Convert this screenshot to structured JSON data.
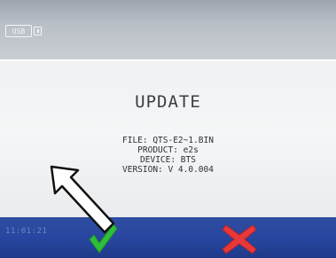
{
  "status_bar": {
    "usb_label": "USB",
    "usb_icon": "usb-connected-icon"
  },
  "dialog": {
    "title": "UPDATE",
    "lines": [
      "FILE: QTS-E2~1.BIN",
      "PRODUCT: e2s",
      "DEVICE: BTS",
      "VERSION: V 4.0.004"
    ]
  },
  "footer": {
    "clock": "11:01:21",
    "confirm_icon": "check-icon",
    "cancel_icon": "cross-icon"
  },
  "colors": {
    "confirm": "#2fbf3a",
    "cancel": "#e8383a",
    "footer_bar": "#2846a0"
  }
}
